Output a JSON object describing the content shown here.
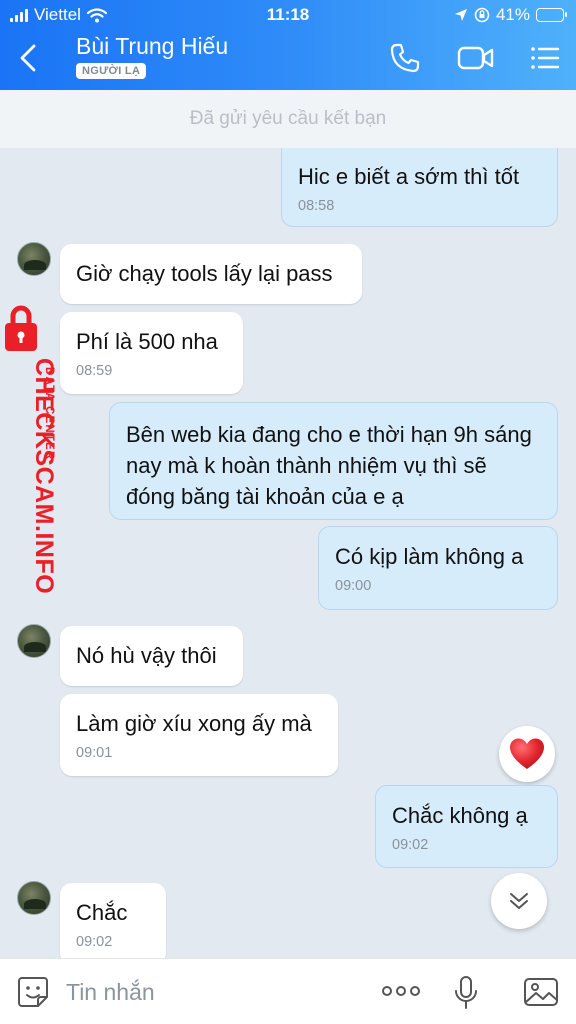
{
  "status_bar": {
    "carrier": "Viettel",
    "time": "11:18",
    "battery": "41%",
    "battery_level": 0.41,
    "icons": [
      "signal-bars-icon",
      "wifi-icon",
      "location-arrow-icon",
      "orientation-lock-icon",
      "battery-icon"
    ]
  },
  "header": {
    "contact_name": "Bùi Trung Hiếu",
    "badge": "NGƯỜI LẠ",
    "icons": [
      "back-chevron-icon",
      "phone-icon",
      "video-camera-icon",
      "menu-list-icon"
    ]
  },
  "banner": {
    "text": "Đã gửi yêu cầu kết bạn"
  },
  "messages": [
    {
      "direction": "out",
      "text": "Hic e biết a sớm thì tốt",
      "time": "08:58"
    },
    {
      "direction": "in",
      "text": "Giờ chạy tools lấy lại pass",
      "time": ""
    },
    {
      "direction": "in",
      "text": "Phí là 500 nha",
      "time": "08:59"
    },
    {
      "direction": "out",
      "text": "Bên web kia đang cho e thời hạn 9h sáng nay mà k hoàn thành nhiệm vụ thì sẽ đóng băng tài khoản của e ạ",
      "time": ""
    },
    {
      "direction": "out",
      "text": "Có kịp làm không a",
      "time": "09:00"
    },
    {
      "direction": "in",
      "text": "Nó hù vậy thôi",
      "time": ""
    },
    {
      "direction": "in",
      "text": "Làm giờ xíu xong ấy mà",
      "time": "09:01"
    },
    {
      "direction": "out",
      "text": "Chắc không ạ",
      "time": "09:02"
    },
    {
      "direction": "in",
      "text": "Chắc",
      "time": "09:02"
    }
  ],
  "reaction": {
    "icon": "heart-icon",
    "color": "#e3262f"
  },
  "scroll_button": {
    "icon": "double-chevron-down-icon"
  },
  "watermark": {
    "title": "CHECKSCAM.INFO",
    "subtitle": "DATA CENTER",
    "icon": "padlock-icon",
    "color": "#ea1f27"
  },
  "composer": {
    "placeholder": "Tin nhắn",
    "icons": [
      "emoji-sticker-icon",
      "more-dots-icon",
      "microphone-icon",
      "image-icon"
    ]
  },
  "colors": {
    "header_gradient_start": "#1a74f5",
    "header_gradient_end": "#4fb1fb",
    "outgoing_bubble": "#d7ecfb",
    "incoming_bubble": "#ffffff",
    "chat_background": "#e2e9f1"
  }
}
